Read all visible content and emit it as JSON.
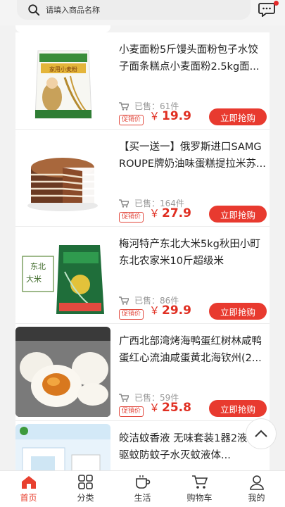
{
  "search": {
    "placeholder": "请填入商品名称"
  },
  "products": [
    {
      "title": "小麦面粉5斤馒头面粉包子水饺子面条糕点小麦面粉2.5kg面...",
      "sold_label": "已售：61件",
      "promo": "促销价",
      "currency": "￥",
      "price": "19.9",
      "buy": "立即抢购",
      "image": "flour-bag"
    },
    {
      "title": "【买一送一】俄罗斯进口SAMGROUPE牌奶油味蛋糕提拉米苏...",
      "sold_label": "已售：164件",
      "promo": "促销价",
      "currency": "￥",
      "price": "27.9",
      "buy": "立即抢购",
      "image": "chocolate-cake"
    },
    {
      "title": "梅河特产东北大米5kg秋田小町东北农家米10斤超级米",
      "sold_label": "已售：86件",
      "promo": "促销价",
      "currency": "￥",
      "price": "29.9",
      "buy": "立即抢购",
      "image": "rice-bag"
    },
    {
      "title": "广西北部湾烤海鸭蛋红树林咸鸭蛋红心流油咸蛋黄北海钦州(2...",
      "sold_label": "已售：59件",
      "promo": "促销价",
      "currency": "￥",
      "price": "25.8",
      "buy": "立即抢购",
      "image": "salted-eggs"
    },
    {
      "title": "皎洁蚊香液 无味套装1器2液电式驱蚊防蚊子水灭蚊液体...",
      "sold_label": "",
      "promo": "",
      "currency": "",
      "price": "",
      "buy": "",
      "image": "mosquito-liquid"
    }
  ],
  "tabbar": [
    {
      "label": "首页",
      "icon": "home-icon",
      "active": true
    },
    {
      "label": "分类",
      "icon": "category-icon",
      "active": false
    },
    {
      "label": "生活",
      "icon": "life-cup-icon",
      "active": false
    },
    {
      "label": "购物车",
      "icon": "cart-icon",
      "active": false
    },
    {
      "label": "我的",
      "icon": "profile-icon",
      "active": false
    }
  ],
  "colors": {
    "accent": "#e83a2f",
    "price": "#e02f22",
    "tab_active": "#e8402f"
  }
}
